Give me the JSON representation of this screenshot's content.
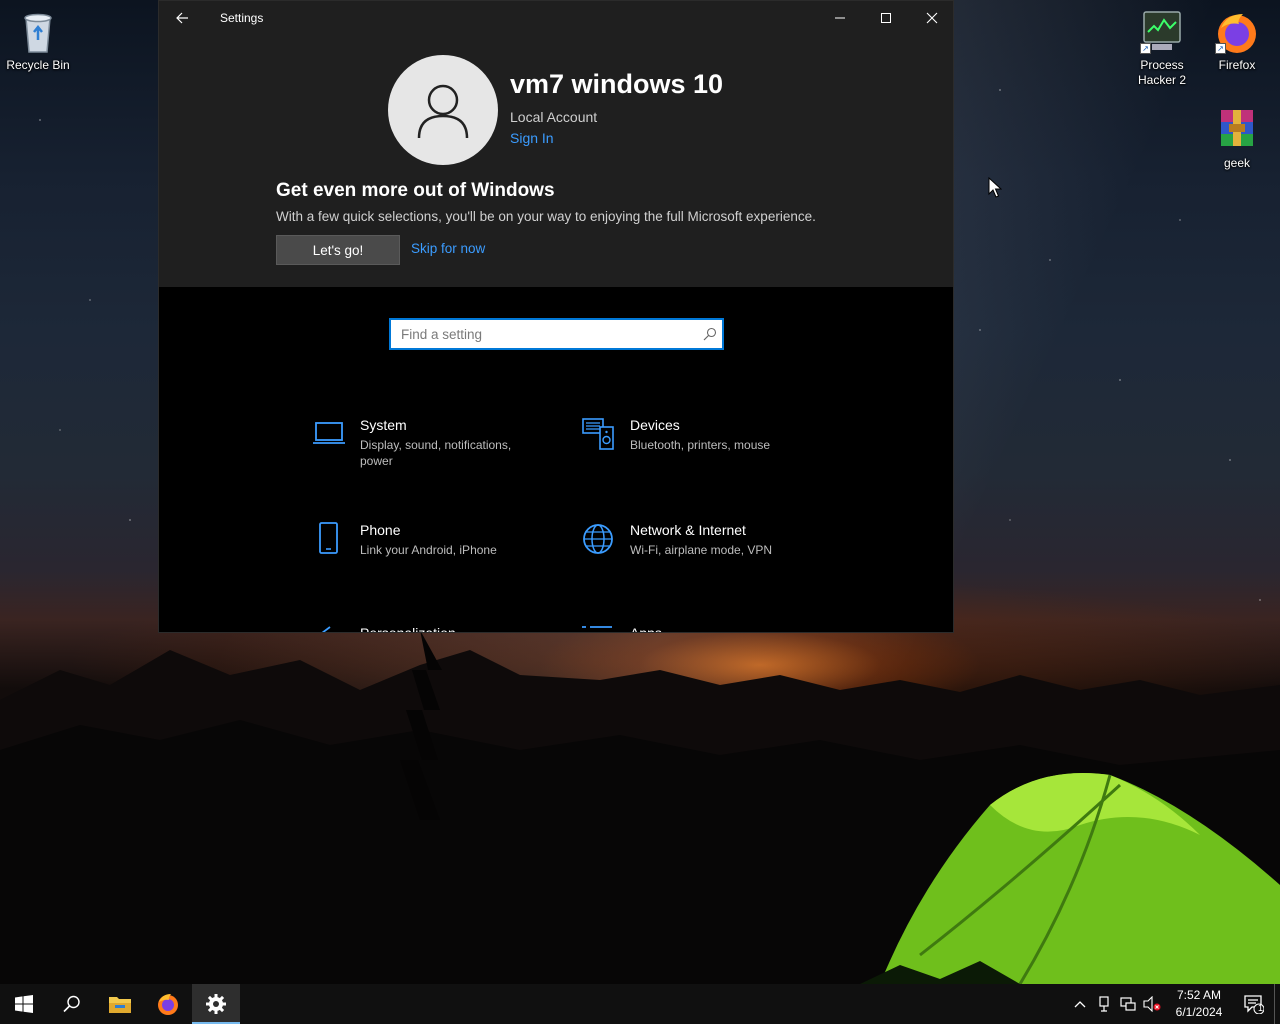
{
  "desktop": {
    "icons": [
      {
        "label": "Recycle Bin",
        "icon": "recycle-bin-icon"
      },
      {
        "label": "Process\nHacker 2",
        "icon": "process-hacker-icon"
      },
      {
        "label": "Firefox",
        "icon": "firefox-icon"
      },
      {
        "label": "geek",
        "icon": "winrar-archive-icon"
      }
    ]
  },
  "window": {
    "title": "Settings",
    "controls": [
      "minimize",
      "maximize",
      "close"
    ]
  },
  "account": {
    "name": "vm7 windows 10",
    "type": "Local Account",
    "sign_in": "Sign In"
  },
  "promo": {
    "title": "Get even more out of Windows",
    "description": "With a few quick selections, you'll be on your way to enjoying the full Microsoft experience.",
    "primary": "Let's go!",
    "secondary": "Skip for now"
  },
  "search": {
    "placeholder": "Find a setting",
    "value": ""
  },
  "categories": [
    {
      "title": "System",
      "desc": "Display, sound, notifications, power",
      "icon": "laptop-icon"
    },
    {
      "title": "Devices",
      "desc": "Bluetooth, printers, mouse",
      "icon": "devices-icon"
    },
    {
      "title": "Phone",
      "desc": "Link your Android, iPhone",
      "icon": "phone-icon"
    },
    {
      "title": "Network & Internet",
      "desc": "Wi-Fi, airplane mode, VPN",
      "icon": "globe-icon"
    },
    {
      "title": "Personalization",
      "desc": "",
      "icon": "brush-icon"
    },
    {
      "title": "Apps",
      "desc": "",
      "icon": "apps-list-icon"
    }
  ],
  "taskbar": {
    "items": [
      "start-icon",
      "search-icon",
      "file-explorer-icon",
      "firefox-icon",
      "settings-gear-icon"
    ],
    "active": "settings-gear-icon",
    "clock": {
      "time": "7:52 AM",
      "date": "6/1/2024"
    },
    "notification_count": "1"
  },
  "colors": {
    "accent": "#0078d7",
    "link": "#3b9cff",
    "window_header": "#1f1f1f",
    "window_body": "#000000",
    "taskbar": "#101010"
  }
}
